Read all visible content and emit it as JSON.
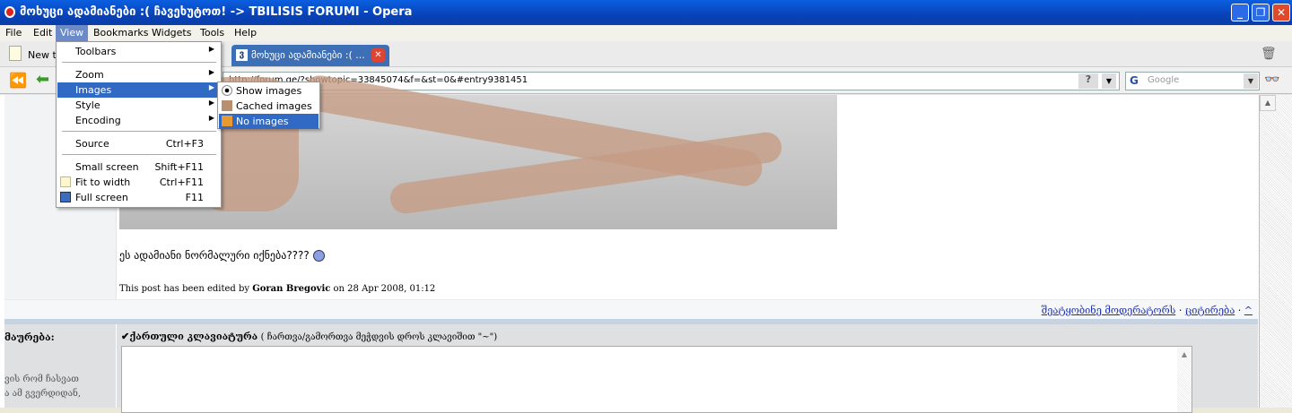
{
  "window": {
    "title": "მოხუცი ადამიანები :( ჩავეხუტოთ! -> TBILISIS FORUMI - Opera"
  },
  "menubar": [
    "File",
    "Edit",
    "View",
    "Bookmarks",
    "Widgets",
    "Tools",
    "Help"
  ],
  "tabs": {
    "new_tab": "New tab",
    "active_tab": "მოხუცი ადამიანები :( ..."
  },
  "address": {
    "url": "http://forum.ge/?showtopic=33845074&f=&st=0&#entry9381451",
    "help": "?",
    "search_placeholder": "Google"
  },
  "view_menu": {
    "items": [
      {
        "label": "Toolbars",
        "shortcut": ""
      },
      {
        "label": "Zoom",
        "shortcut": ""
      },
      {
        "label": "Images",
        "shortcut": ""
      },
      {
        "label": "Style",
        "shortcut": ""
      },
      {
        "label": "Encoding",
        "shortcut": ""
      },
      {
        "label": "Source",
        "shortcut": "Ctrl+F3"
      },
      {
        "label": "Small screen",
        "shortcut": "Shift+F11"
      },
      {
        "label": "Fit to width",
        "shortcut": "Ctrl+F11"
      },
      {
        "label": "Full screen",
        "shortcut": "F11"
      }
    ],
    "images_submenu": [
      "Show images",
      "Cached images",
      "No images"
    ]
  },
  "post": {
    "text": "ეს ადამიანი ნორმალური იქნება????",
    "edited_prefix": "This post has been edited by ",
    "edited_user": "Goran Bregovic",
    "edited_suffix": " on 28 Apr 2008, 01:12",
    "link_report": "შეატყობინე მოდერატორს",
    "link_quote": "ციტირება",
    "link_top": "^",
    "dot": " · "
  },
  "reply": {
    "left_label": "მაურება:",
    "left_line1": "ვის რომ ჩასვათ",
    "left_line2": "ა ამ გვერდიდან,",
    "keyboard_label": "ქართული კლავიატურა",
    "keyboard_hint": "( ჩართვა/გამორთვა მეჭდვის დროს კლავიშით \"~\")"
  },
  "colors": {
    "titlebar": "#0842b8",
    "highlight": "#316ac5",
    "link": "#2233aa"
  }
}
